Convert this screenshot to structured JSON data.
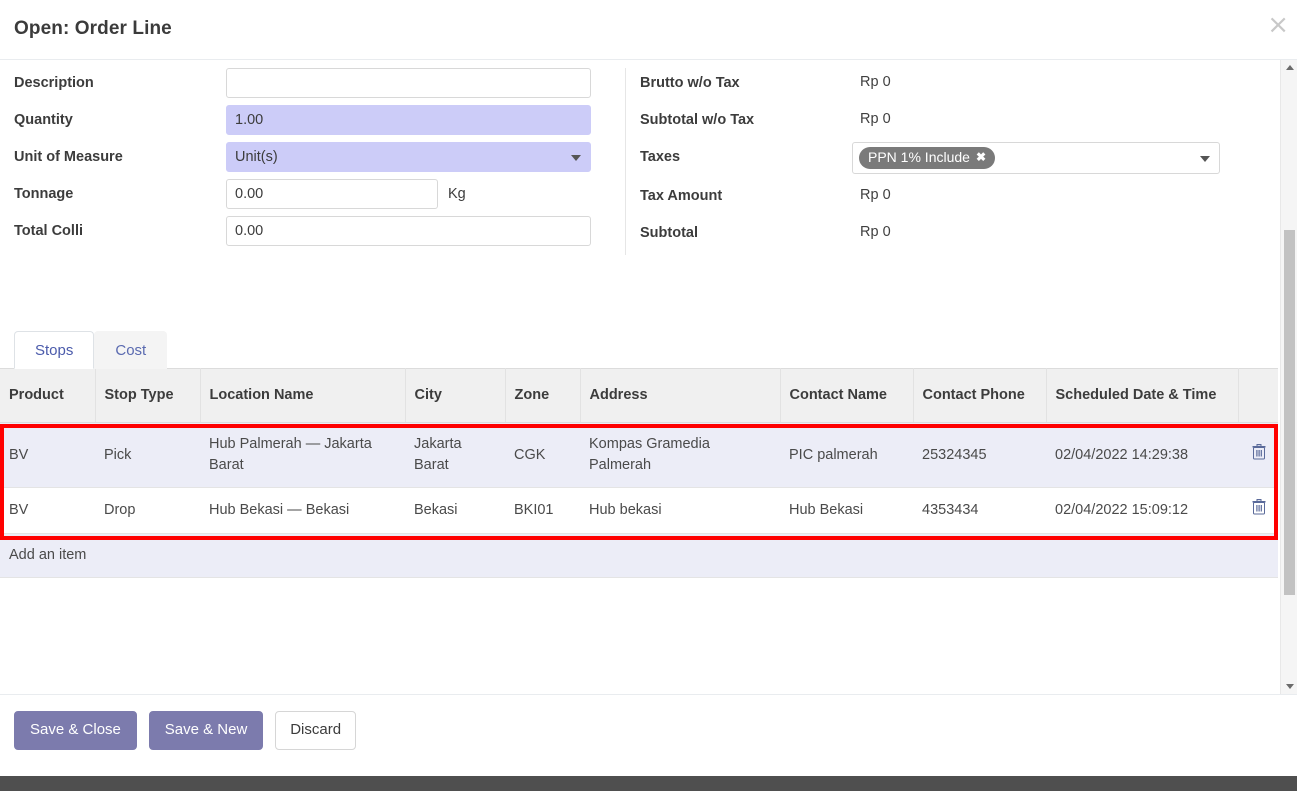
{
  "dialog": {
    "title": "Open: Order Line",
    "close_label": "×"
  },
  "form": {
    "left": [
      {
        "label": "Description",
        "value": "",
        "type": "input",
        "highlight": false
      },
      {
        "label": "Quantity",
        "value": "1.00",
        "type": "input",
        "highlight": true
      },
      {
        "label": "Unit of Measure",
        "value": "Unit(s)",
        "type": "select",
        "highlight": true
      },
      {
        "label": "Tonnage",
        "value": "0.00",
        "type": "input",
        "highlight": false,
        "suffix": "Kg"
      },
      {
        "label": "Total Colli",
        "value": "0.00",
        "type": "input",
        "highlight": false
      }
    ],
    "right": [
      {
        "label": "Brutto w/o Tax",
        "value": "Rp 0",
        "type": "readonly"
      },
      {
        "label": "Subtotal w/o Tax",
        "value": "Rp 0",
        "type": "readonly"
      },
      {
        "label": "Taxes",
        "value": "PPN 1% Include",
        "type": "tags"
      },
      {
        "label": "Tax Amount",
        "value": "Rp 0",
        "type": "readonly"
      },
      {
        "label": "Subtotal",
        "value": "Rp 0",
        "type": "readonly"
      }
    ],
    "labels": {
      "description": "Description",
      "quantity": "Quantity",
      "unit_of_measure": "Unit of Measure",
      "tonnage": "Tonnage",
      "total_colli": "Total Colli",
      "brutto_wo_tax": "Brutto w/o Tax",
      "subtotal_wo_tax": "Subtotal w/o Tax",
      "taxes": "Taxes",
      "tax_amount": "Tax Amount",
      "subtotal": "Subtotal"
    },
    "values": {
      "description": "",
      "quantity": "1.00",
      "unit_of_measure": "Unit(s)",
      "tonnage": "0.00",
      "tonnage_unit": "Kg",
      "total_colli": "0.00",
      "brutto_wo_tax": "Rp 0",
      "subtotal_wo_tax": "Rp 0",
      "tax_tag": "PPN 1% Include",
      "tax_tag_remove": "✖",
      "tax_amount": "Rp 0",
      "subtotal": "Rp 0"
    }
  },
  "tabs": [
    {
      "label": "Stops",
      "active": true
    },
    {
      "label": "Cost",
      "active": false
    }
  ],
  "table": {
    "headers": [
      "Product",
      "Stop Type",
      "Location Name",
      "City",
      "Zone",
      "Address",
      "Contact Name",
      "Contact Phone",
      "Scheduled Date & Time",
      ""
    ],
    "rows": [
      {
        "product": "BV",
        "stop_type": "Pick",
        "location_name": "Hub Palmerah — Jakarta Barat",
        "city": "Jakarta Barat",
        "zone": "CGK",
        "address": "Kompas Gramedia Palmerah",
        "contact_name": "PIC palmerah",
        "contact_phone": "25324345",
        "scheduled": "02/04/2022 14:29:38"
      },
      {
        "product": "BV",
        "stop_type": "Drop",
        "location_name": "Hub Bekasi — Bekasi",
        "city": "Bekasi",
        "zone": "BKI01",
        "address": "Hub bekasi",
        "contact_name": "Hub Bekasi",
        "contact_phone": "4353434",
        "scheduled": "02/04/2022 15:09:12"
      }
    ],
    "add_item_label": "Add an item"
  },
  "footer": {
    "save_close": "Save & Close",
    "save_new": "Save & New",
    "discard": "Discard"
  },
  "colors": {
    "accent": "#7c7bad",
    "highlight_field": "#ccccf8",
    "row_selected": "#ecedf7",
    "tag": "#7a7a7a",
    "annotation": "#ff0000"
  }
}
